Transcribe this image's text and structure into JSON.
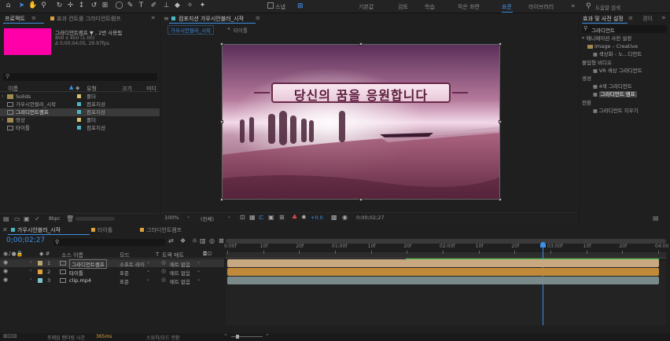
{
  "toolbar": {
    "workspaces": [
      "기본값",
      "검토",
      "학습",
      "작은 화면",
      "표준",
      "라이브러리"
    ],
    "active_workspace": "표준",
    "snap_label": "스냅",
    "search_placeholder": "도움말 검색"
  },
  "project": {
    "tab_project": "프로젝트",
    "tab_effects": "효과 컨트롤 그라디언트램프",
    "comp_name": "그라디언트램프 ▼ , 2번 사용됨",
    "comp_size": "800 x 450 (1.00)",
    "comp_duration": "Δ 0;00;04;05, 29.97fps",
    "preview_color": "#ff00a8",
    "search_placeholder": "",
    "headers": {
      "name": "이름",
      "type": "유형",
      "size": "크기",
      "media": "미디"
    },
    "items": [
      {
        "name": "Solids",
        "type": "폴더",
        "size": "",
        "color": "#d8c46a",
        "kind": "folder"
      },
      {
        "name": "가우시안블러_시작",
        "type": "컴포지션",
        "size": "",
        "color": "#4bb7c2",
        "kind": "comp"
      },
      {
        "name": "그라디언트램프",
        "type": "컴포지션",
        "size": "",
        "color": "#4bb7c2",
        "kind": "comp",
        "selected": true
      },
      {
        "name": "영상",
        "type": "폴더",
        "size": "",
        "color": "#d8c46a",
        "kind": "folder"
      },
      {
        "name": "타이틀",
        "type": "컴포지션",
        "size": "",
        "color": "#4bb7c2",
        "kind": "comp"
      }
    ],
    "bpc": "8bpc"
  },
  "composition": {
    "tab_label": "컴포지션 가우시안블러_시작",
    "subtab_active": "가우시안블러_시작",
    "subtab_other": "타이틀",
    "title_text": "당신의 꿈을 응원합니다",
    "zoom": "100%",
    "quality": "(전체)",
    "exposure": "+0.0",
    "timecode": "0;00;02;27"
  },
  "effects": {
    "tab_label": "효과 및 사전 설정",
    "tab_other": "경이",
    "search_value": "그라디언트",
    "groups": [
      {
        "label": "* 애니메이션 사전 설정",
        "indent": 0
      },
      {
        "label": "Image – Creative",
        "indent": 1
      },
      {
        "label": "색상화 - 노...디언트",
        "indent": 2
      },
      {
        "label": "몰입형 비디오",
        "indent": 0
      },
      {
        "label": "VR 색상 그라디언트",
        "indent": 2
      },
      {
        "label": "생성",
        "indent": 0
      },
      {
        "label": "4색 그라디언트",
        "indent": 2
      },
      {
        "label": "그라디언트 램프",
        "indent": 2,
        "selected": true
      },
      {
        "label": "전환",
        "indent": 0
      },
      {
        "label": "그라디언트 지우기",
        "indent": 2
      }
    ]
  },
  "timeline": {
    "tabs": [
      "가우시안블러_시작",
      "타이틀",
      "그라디언트램프"
    ],
    "tab_colors": [
      "#4bb7c2",
      "#e0a23a",
      "#e0a23a"
    ],
    "timecode": "0;00;02;27",
    "headers": {
      "source": "소스 이름",
      "mode": "모드",
      "t": "T",
      "matte": "트랙 매트"
    },
    "layers": [
      {
        "num": "1",
        "name": "그라디언트램프",
        "mode": "소프트 라이",
        "matte": "매트 없음",
        "color": "#b8a46e",
        "bar": "#c8a880",
        "selected": true
      },
      {
        "num": "2",
        "name": "타이틀",
        "mode": "표준",
        "matte": "매트 없음",
        "color": "#e0a23a",
        "bar": "#c08a3a"
      },
      {
        "num": "3",
        "name": "clip.mp4",
        "mode": "표준",
        "matte": "매트 없음",
        "color": "#7fc4c8",
        "bar": "#7a8a8a"
      }
    ],
    "ruler": [
      "0:00f",
      "10f",
      "20f",
      "01:00f",
      "10f",
      "20f",
      "02:00f",
      "10f",
      "20f",
      "03:00f",
      "10f",
      "20f",
      "04:00"
    ],
    "playhead_fraction": 0.72,
    "render_label": "프레임 렌더링 시간",
    "render_value": "365ms",
    "toggle_label": "스위치/모드 전환"
  }
}
